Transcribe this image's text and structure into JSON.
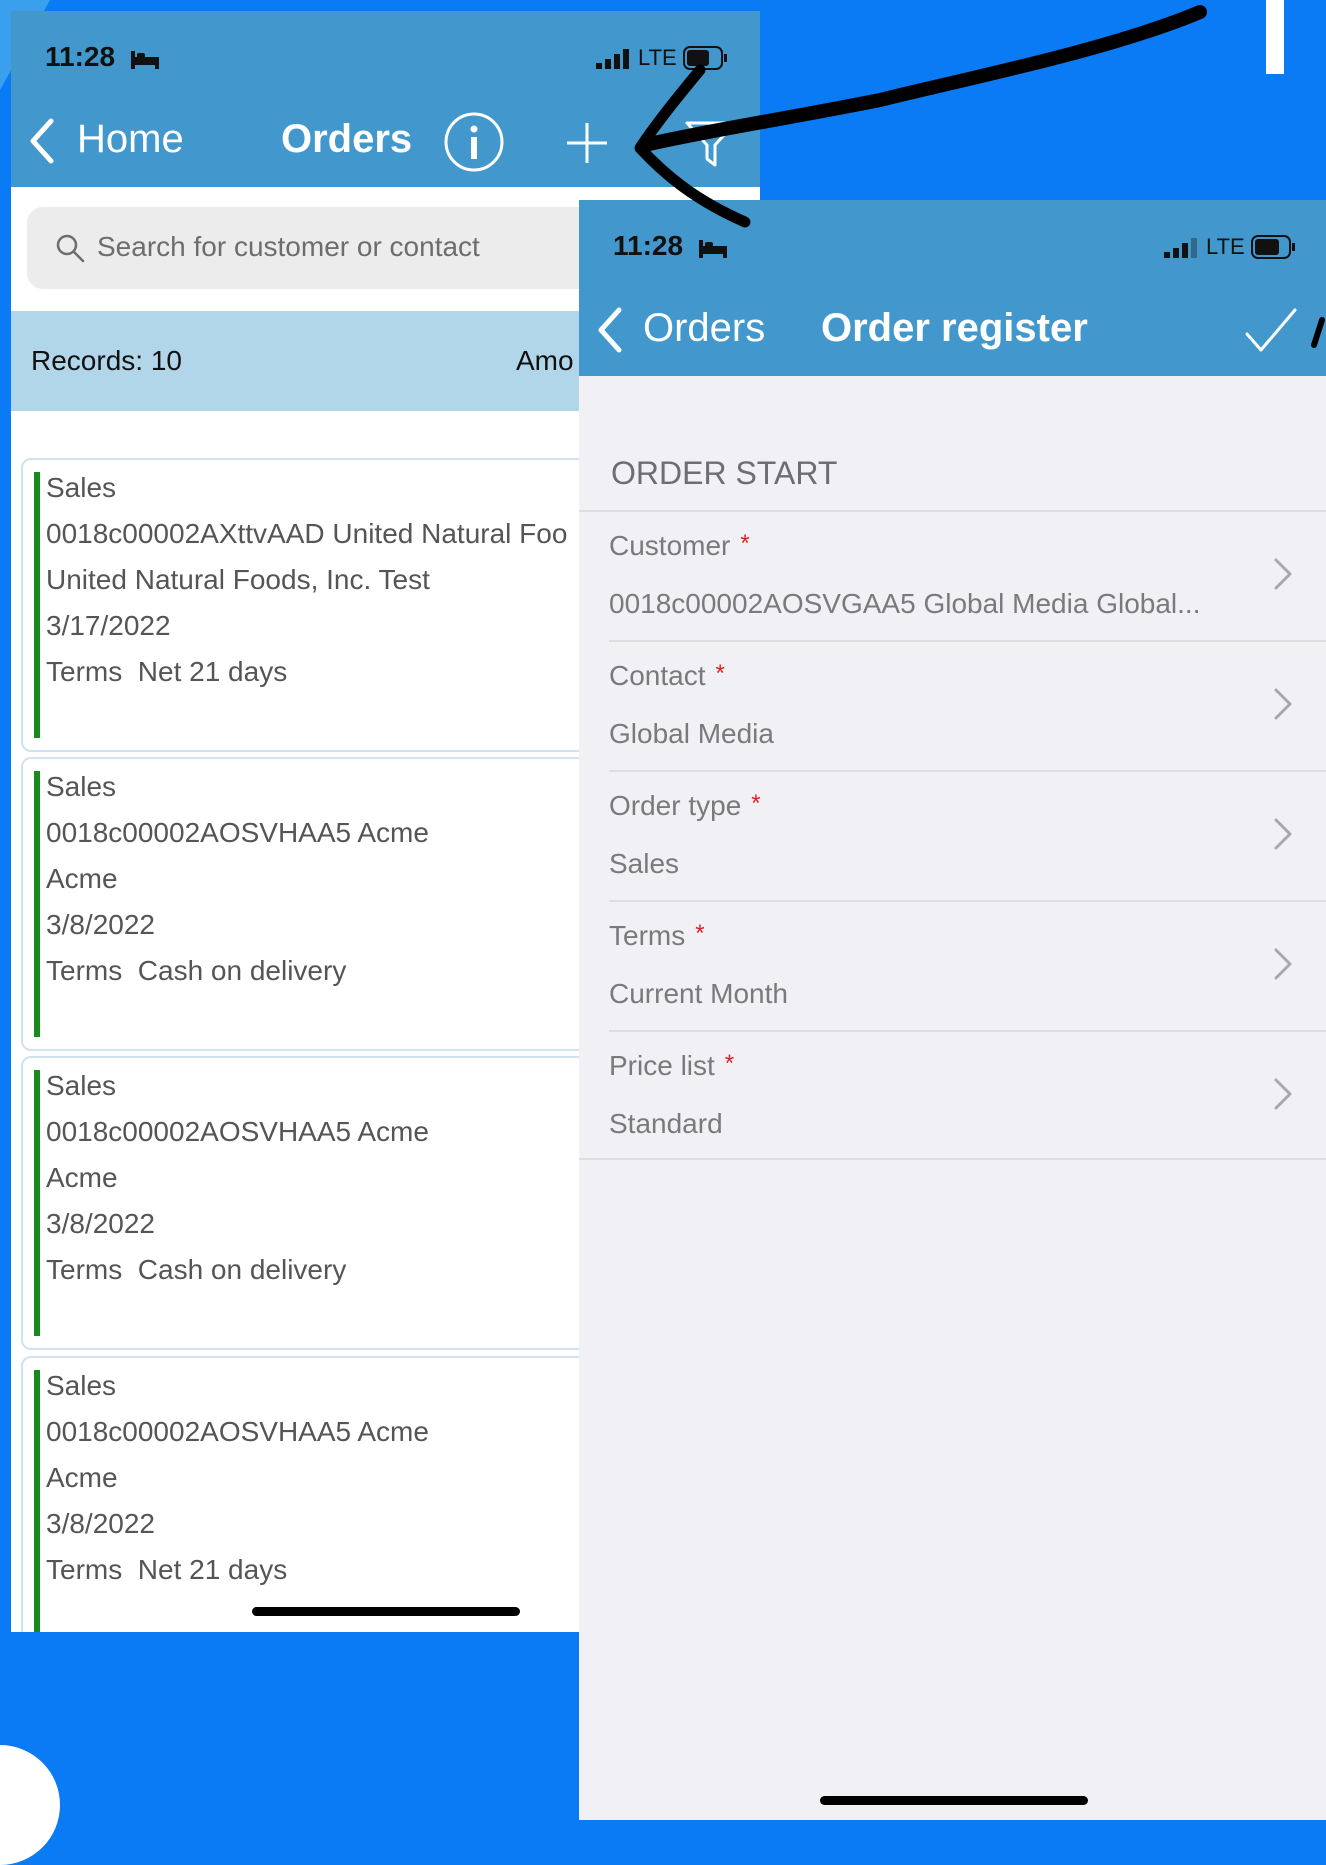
{
  "orders_screen": {
    "status": {
      "time": "11:28",
      "carrier": "LTE"
    },
    "nav": {
      "back_label": "Home",
      "title": "Orders"
    },
    "search": {
      "placeholder": "Search for customer or contact"
    },
    "records": {
      "count_label": "Records: 10",
      "amount_label": "Amo"
    },
    "cards": [
      {
        "type": "Sales",
        "account": "0018c00002AXttvAAD United Natural Foo",
        "customer": "United Natural Foods, Inc. Test",
        "date": "3/17/2022",
        "terms": "Terms  Net 21 days"
      },
      {
        "type": "Sales",
        "account": "0018c00002AOSVHAA5 Acme",
        "customer": "Acme",
        "date": "3/8/2022",
        "terms": "Terms  Cash on delivery"
      },
      {
        "type": "Sales",
        "account": "0018c00002AOSVHAA5 Acme",
        "customer": "Acme",
        "date": "3/8/2022",
        "terms": "Terms  Cash on delivery"
      },
      {
        "type": "Sales",
        "account": "0018c00002AOSVHAA5 Acme",
        "customer": "Acme",
        "date": "3/8/2022",
        "terms": "Terms  Net 21 days"
      }
    ]
  },
  "order_register_screen": {
    "status": {
      "time": "11:28",
      "carrier": "LTE"
    },
    "nav": {
      "back_label": "Orders",
      "title": "Order register"
    },
    "section_title": "ORDER START",
    "required_marker": "*",
    "fields": [
      {
        "label": "Customer",
        "value": "0018c00002AOSVGAA5 Global Media Global..."
      },
      {
        "label": "Contact",
        "value": "Global Media"
      },
      {
        "label": "Order type",
        "value": "Sales"
      },
      {
        "label": "Terms",
        "value": "Current Month"
      },
      {
        "label": "Price list",
        "value": "Standard"
      }
    ]
  },
  "colors": {
    "background": "#0a7af5",
    "nav_bar": "#4298cc",
    "records_bar": "#b1d6ea",
    "card_stripe": "#1a8a1a",
    "required": "#e02020"
  },
  "icons": [
    "bed-icon",
    "signal-icon",
    "battery-icon",
    "chevron-left-icon",
    "info-icon",
    "plus-icon",
    "filter-icon",
    "search-icon",
    "checkmark-icon",
    "chevron-right-icon",
    "annotation-arrow"
  ]
}
